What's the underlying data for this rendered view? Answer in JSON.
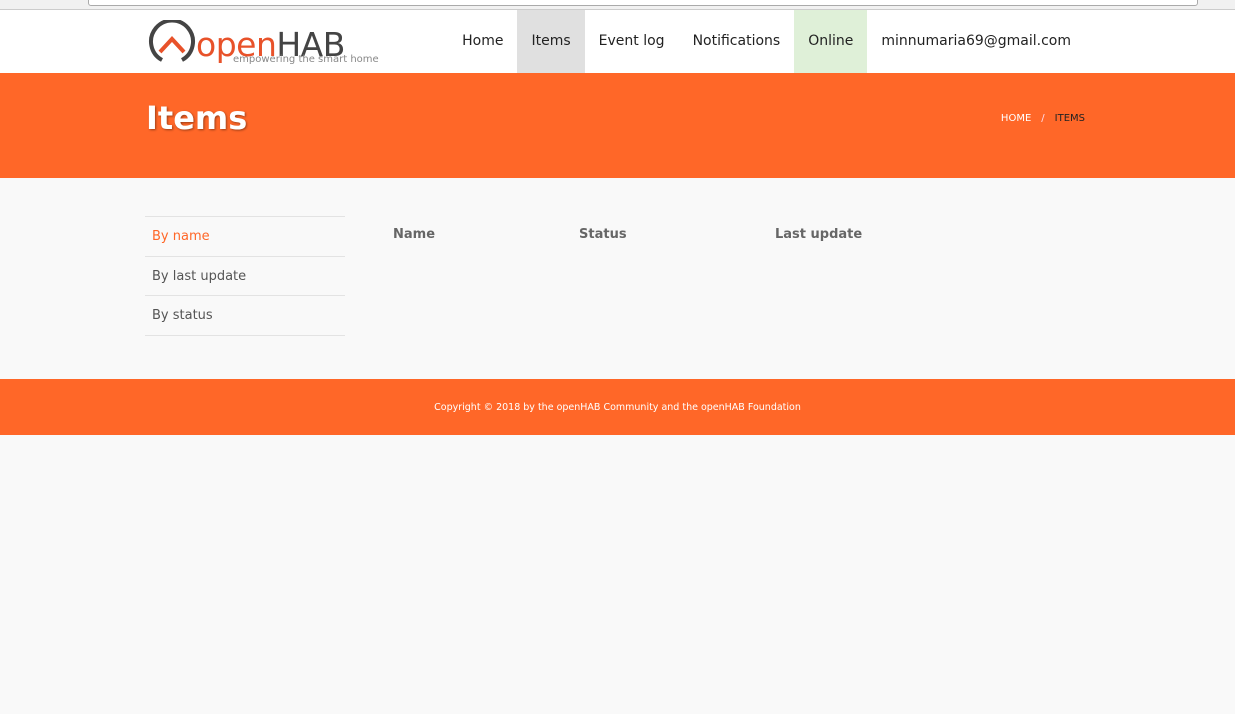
{
  "header": {
    "logo_open": "open",
    "logo_hab": "HAB",
    "logo_tagline": "empowering the smart home",
    "nav": [
      {
        "label": "Home"
      },
      {
        "label": "Items"
      },
      {
        "label": "Event log"
      },
      {
        "label": "Notifications"
      },
      {
        "label": "Online"
      },
      {
        "label": "minnumaria69@gmail.com"
      }
    ]
  },
  "banner": {
    "title": "Items",
    "breadcrumb": {
      "home": "HOME",
      "sep": "/",
      "current": "ITEMS"
    }
  },
  "sidebar": {
    "items": [
      {
        "label": "By name"
      },
      {
        "label": "By last update"
      },
      {
        "label": "By status"
      }
    ]
  },
  "table": {
    "columns": [
      "Name",
      "Status",
      "Last update"
    ]
  },
  "footer": {
    "text": "Copyright © 2018 by the openHAB Community and the openHAB Foundation"
  },
  "colors": {
    "brand": "#ff6728",
    "online_bg": "#dff0d8"
  }
}
